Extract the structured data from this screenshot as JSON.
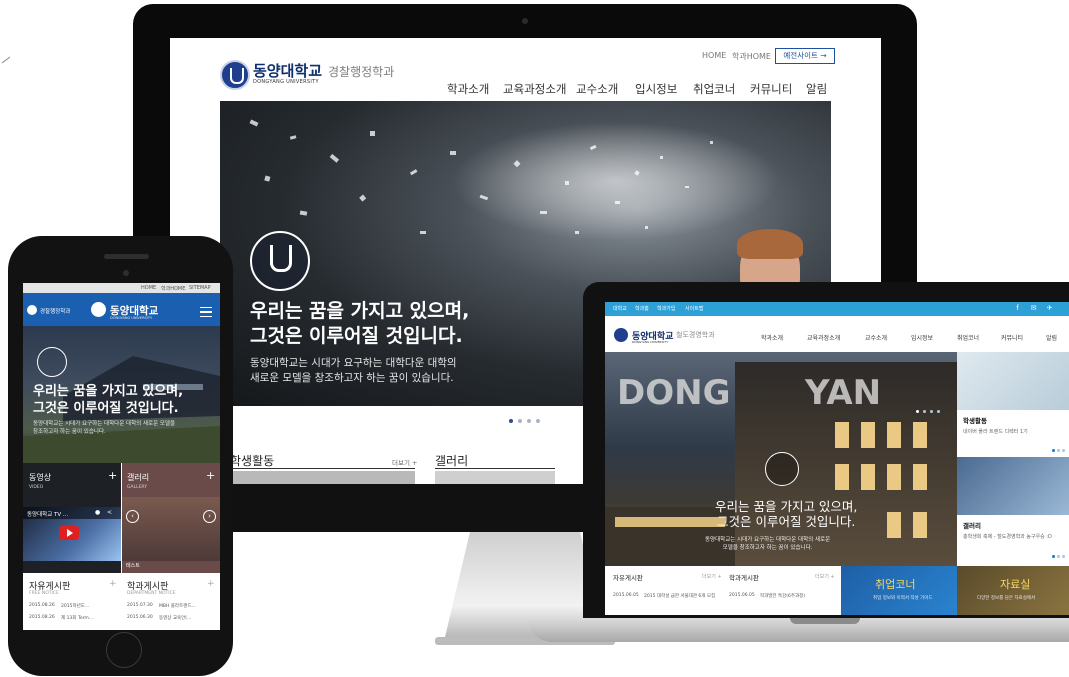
{
  "desktop": {
    "util_links": [
      "HOME",
      "학과HOME"
    ],
    "prev_site_button": "예전사이트 →",
    "logo_text": "동양대학교",
    "logo_sub": "DONGYANG UNIVERSITY",
    "dept_name": "경찰행정학과",
    "nav": [
      "학과소개",
      "교육과정소개",
      "교수소개",
      "입시정보",
      "취업코너",
      "커뮤니티",
      "알림"
    ],
    "hero": {
      "title_line1": "우리는 꿈을 가지고 있으며,",
      "title_line2": "그것은 이루어질 것입니다.",
      "desc_line1": "동양대학교는 시대가 요구하는 대학다운 대학의",
      "desc_line2": "새로운 모델을 창조하고자 하는 꿈이 있습니다."
    },
    "sections": {
      "student_activity": "학생활동",
      "more": "더보기 +",
      "gallery": "갤러리"
    }
  },
  "phone": {
    "util_links": [
      "HOME",
      "학과HOME",
      "SITEMAP"
    ],
    "dept_name": "경찰행정학과",
    "logo_text": "동양대학교",
    "logo_sub": "DONGYANG UNIVERSITY",
    "hero": {
      "title_line1": "우리는 꿈을 가지고 있으며,",
      "title_line2": "그것은 이루어질 것입니다.",
      "desc_line1": "동양대학교는 시대가 요구하는 대학다운 대학의 새로운 모델을",
      "desc_line2": "창조하고자 하는 꿈이 있습니다."
    },
    "video": {
      "title": "동영상",
      "sub": "VIDEO",
      "caption": "동양대학교 TV ..."
    },
    "gallery": {
      "title": "갤러리",
      "sub": "GALLERY",
      "caption": "테스트"
    },
    "free_board": {
      "title": "자유게시판",
      "sub": "FREE NOTICE",
      "rows": [
        {
          "date": "2015.08.26",
          "text": "2015학년도..."
        },
        {
          "date": "2015.08.26",
          "text": "제 13회 Term..."
        }
      ]
    },
    "dept_board": {
      "title": "학과게시판",
      "sub": "DEPARTMENT NOTICE",
      "rows": [
        {
          "date": "2015.07.30",
          "text": "MBH 플라트랜드..."
        },
        {
          "date": "2015.06.30",
          "text": "동영상 교육안(..."
        }
      ]
    }
  },
  "laptop": {
    "util_links": [
      "대학교",
      "학과홈",
      "학과가입",
      "사이트맵"
    ],
    "social": [
      "f",
      "✉",
      "✈"
    ],
    "logo_text": "동양대학교",
    "logo_sub": "DONGYANG UNIVERSITY",
    "dept_name": "철도경영학과",
    "nav": [
      "학과소개",
      "교육과정소개",
      "교수소개",
      "입시정보",
      "취업코너",
      "커뮤니티",
      "알림"
    ],
    "hero": {
      "title_line1": "우리는 꿈을 가지고 있으며,",
      "title_line2": "그것은 이루어질 것입니다.",
      "desc_line1": "동양대학교는 시대가 요구하는 대학다운 대학의 새로운",
      "desc_line2": "모델을 창조하고자 하는 꿈이 있습니다."
    },
    "side1": {
      "title": "학생활동",
      "desc": "네이버 플라 트랜드 디렉터 1기"
    },
    "side2": {
      "title": "갤러리",
      "desc": "총학생회 축제 - 철도경영학과 농구우승 :D"
    },
    "free_board": {
      "title": "자유게시판",
      "more": "더보기 +",
      "row_date": "2015.06.05",
      "row_text": "2015 대학설 급한 서울대관 6개 모집"
    },
    "dept_board": {
      "title": "학과게시판",
      "more": "더보기 +",
      "row_date": "2015.06.05",
      "row_text": "학과발전 특강(6주과정)"
    },
    "career": {
      "title": "취업코너",
      "desc": "취업 정보와 이력서 작성 가이드"
    },
    "data": {
      "title": "자료실",
      "desc": "다양한 정보를 담은 자료실에서"
    }
  },
  "colors": {
    "brand_navy": "#0f2f6e",
    "brand_blue": "#1b5fb0",
    "laptop_topbar": "#2ea0d8",
    "accent_yellow": "#f8d862"
  }
}
